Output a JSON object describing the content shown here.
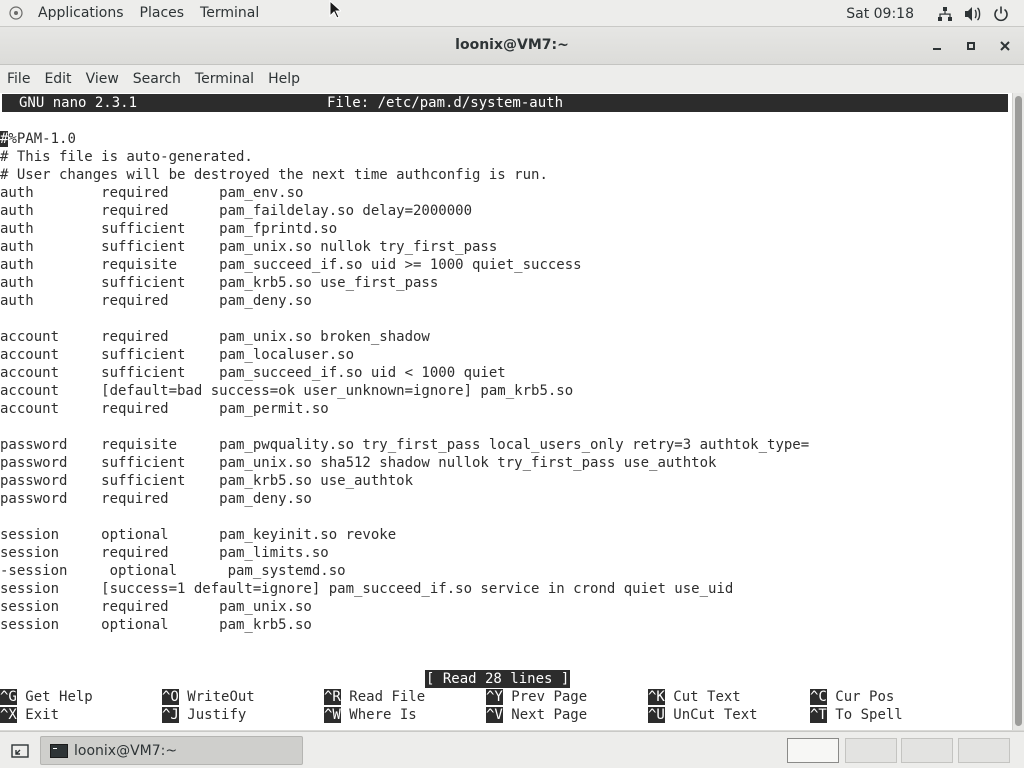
{
  "top_panel": {
    "applications": "Applications",
    "places": "Places",
    "terminal": "Terminal",
    "clock": "Sat 09:18",
    "icons": [
      "network-icon",
      "volume-icon",
      "power-icon"
    ]
  },
  "window": {
    "title": "loonix@VM7:~",
    "buttons": [
      "minimize",
      "maximize",
      "close"
    ]
  },
  "menubar": [
    "File",
    "Edit",
    "View",
    "Search",
    "Terminal",
    "Help"
  ],
  "nano": {
    "program": "GNU nano 2.3.1",
    "file": "File: /etc/pam.d/system-auth",
    "cursor_char": "#",
    "first_line_rest": "%PAM-1.0",
    "lines": [
      "# This file is auto-generated.",
      "# User changes will be destroyed the next time authconfig is run.",
      "auth        required      pam_env.so",
      "auth        required      pam_faildelay.so delay=2000000",
      "auth        sufficient    pam_fprintd.so",
      "auth        sufficient    pam_unix.so nullok try_first_pass",
      "auth        requisite     pam_succeed_if.so uid >= 1000 quiet_success",
      "auth        sufficient    pam_krb5.so use_first_pass",
      "auth        required      pam_deny.so",
      "",
      "account     required      pam_unix.so broken_shadow",
      "account     sufficient    pam_localuser.so",
      "account     sufficient    pam_succeed_if.so uid < 1000 quiet",
      "account     [default=bad success=ok user_unknown=ignore] pam_krb5.so",
      "account     required      pam_permit.so",
      "",
      "password    requisite     pam_pwquality.so try_first_pass local_users_only retry=3 authtok_type=",
      "password    sufficient    pam_unix.so sha512 shadow nullok try_first_pass use_authtok",
      "password    sufficient    pam_krb5.so use_authtok",
      "password    required      pam_deny.so",
      "",
      "session     optional      pam_keyinit.so revoke",
      "session     required      pam_limits.so",
      "-session     optional      pam_systemd.so",
      "session     [success=1 default=ignore] pam_succeed_if.so service in crond quiet use_uid",
      "session     required      pam_unix.so",
      "session     optional      pam_krb5.so"
    ],
    "status": "[ Read 28 lines ]",
    "shortcuts": [
      {
        "key": "^G",
        "label": "Get Help"
      },
      {
        "key": "^O",
        "label": "WriteOut"
      },
      {
        "key": "^R",
        "label": "Read File"
      },
      {
        "key": "^Y",
        "label": "Prev Page"
      },
      {
        "key": "^K",
        "label": "Cut Text"
      },
      {
        "key": "^C",
        "label": "Cur Pos"
      },
      {
        "key": "^X",
        "label": "Exit"
      },
      {
        "key": "^J",
        "label": "Justify"
      },
      {
        "key": "^W",
        "label": "Where Is"
      },
      {
        "key": "^V",
        "label": "Next Page"
      },
      {
        "key": "^U",
        "label": "UnCut Text"
      },
      {
        "key": "^T",
        "label": "To Spell"
      }
    ]
  },
  "taskbar": {
    "task_label": "loonix@VM7:~"
  }
}
